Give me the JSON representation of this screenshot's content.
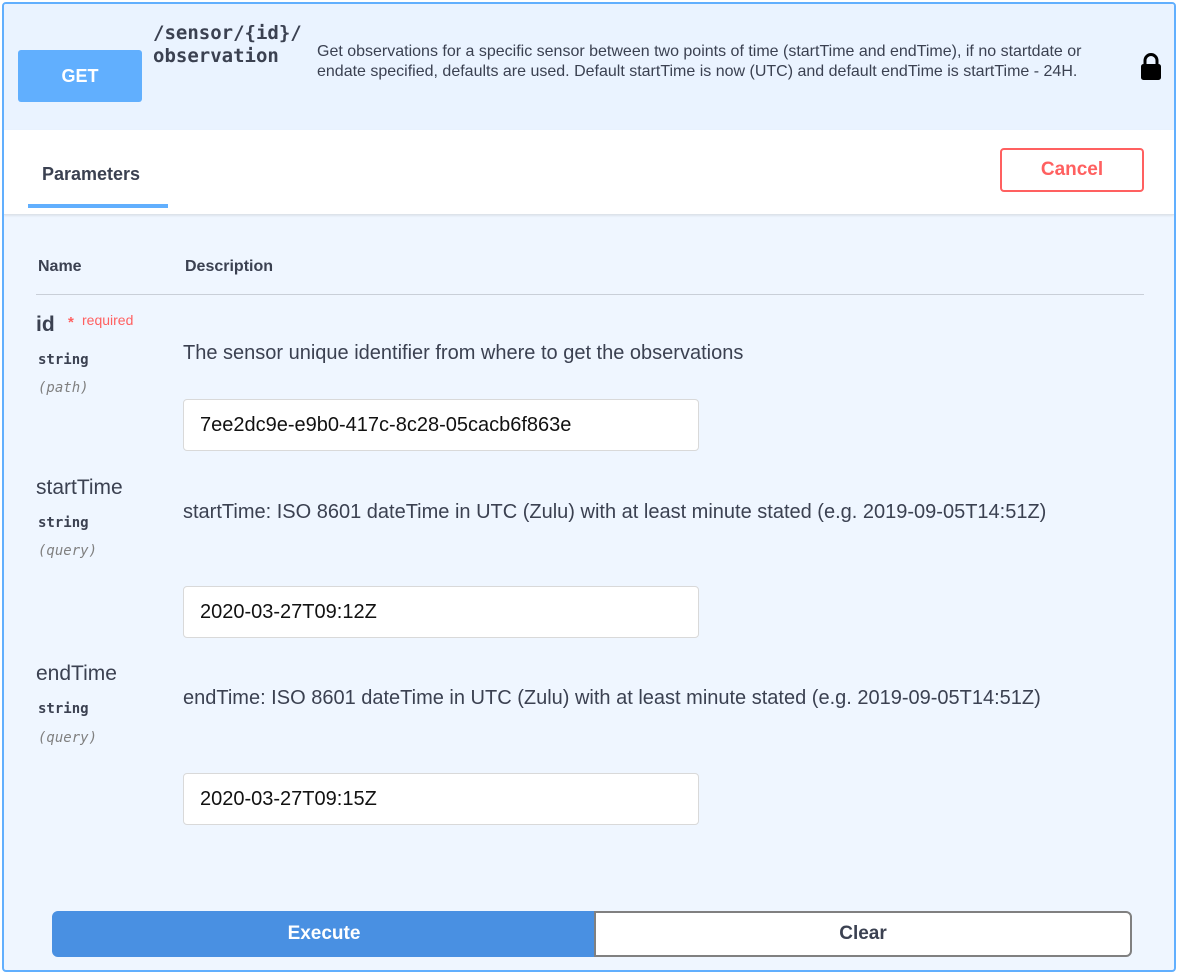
{
  "operation": {
    "method": "GET",
    "path": "/sensor/{id}/observation",
    "description": "Get observations for a specific sensor between two points of time (startTime and endTime), if no startdate or endate specified, defaults are used. Default startTime is now (UTC) and default endTime is startTime - 24H.",
    "lock_icon": "lock-icon"
  },
  "tabs": {
    "parameters_label": "Parameters"
  },
  "actions": {
    "cancel_label": "Cancel",
    "execute_label": "Execute",
    "clear_label": "Clear"
  },
  "table": {
    "name_header": "Name",
    "description_header": "Description"
  },
  "params": [
    {
      "name": "id",
      "required_star": "*",
      "required_label": "required",
      "type": "string",
      "in": "(path)",
      "description": "The sensor unique identifier from where to get the observations",
      "value": "7ee2dc9e-e9b0-417c-8c28-05cacb6f863e"
    },
    {
      "name": "startTime",
      "type": "string",
      "in": "(query)",
      "description": "startTime: ISO 8601 dateTime in UTC (Zulu) with at least minute stated (e.g. 2019-09-05T14:51Z)",
      "value": "2020-03-27T09:12Z"
    },
    {
      "name": "endTime",
      "type": "string",
      "in": "(query)",
      "description": "endTime: ISO 8601 dateTime in UTC (Zulu) with at least minute stated (e.g. 2019-09-05T14:51Z)",
      "value": "2020-03-27T09:15Z"
    }
  ],
  "colors": {
    "get_accent": "#61affe",
    "cancel_red": "#ff6060",
    "execute_blue": "#4990e2",
    "panel_bg": "#eff6ff"
  }
}
